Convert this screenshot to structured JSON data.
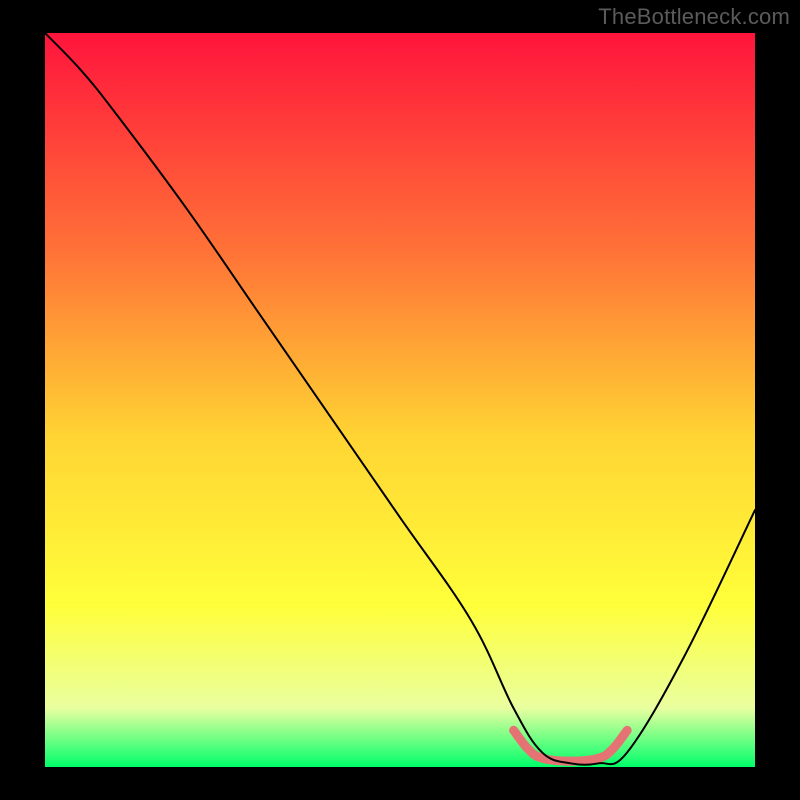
{
  "attribution": "TheBottleneck.com",
  "chart_data": {
    "type": "line",
    "title": "",
    "xlabel": "",
    "ylabel": "",
    "xlim": [
      0,
      100
    ],
    "ylim": [
      0,
      100
    ],
    "grid": false,
    "series": [
      {
        "name": "bottleneck-curve",
        "x": [
          0,
          5,
          10,
          20,
          30,
          40,
          50,
          60,
          66,
          70,
          74,
          78,
          82,
          90,
          100
        ],
        "values": [
          100,
          95,
          89,
          76,
          62,
          48,
          34,
          20,
          8,
          2,
          0.5,
          0.5,
          2,
          15,
          35
        ],
        "stroke": "#000000",
        "stroke_width": 2.0
      },
      {
        "name": "optimal-range-marker",
        "x": [
          66,
          68,
          70,
          74,
          78,
          80,
          82
        ],
        "values": [
          5,
          2.5,
          1.2,
          0.8,
          1.2,
          2.5,
          5
        ],
        "stroke": "#e57373",
        "stroke_width": 9
      }
    ],
    "background_gradient": {
      "top": "#ff143c",
      "mid1": "#ff7337",
      "mid2": "#ffd433",
      "mid3": "#ffff3a",
      "mid4": "#e9ffa0",
      "bottom": "#00ff6a"
    }
  }
}
